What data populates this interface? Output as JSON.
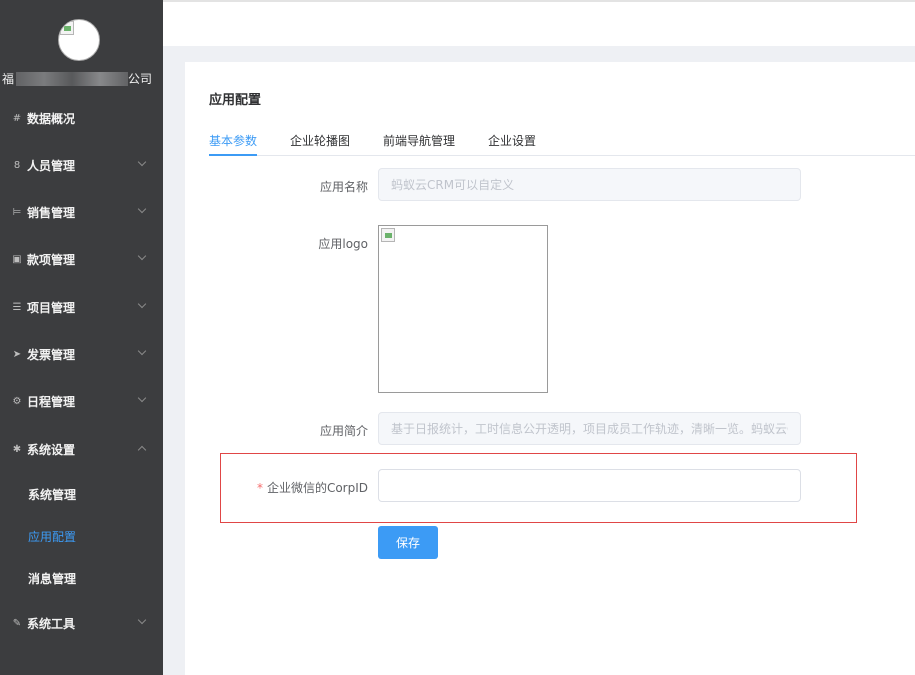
{
  "sidebar": {
    "company": {
      "prefix": "福",
      "suffix": "公司"
    },
    "items": [
      {
        "icon": "#",
        "label": "数据概况"
      },
      {
        "icon": "8",
        "label": "人员管理"
      },
      {
        "icon": "⊨",
        "label": "销售管理"
      },
      {
        "icon": "▣",
        "label": "款项管理"
      },
      {
        "icon": "☰",
        "label": "项目管理"
      },
      {
        "icon": "➤",
        "label": "发票管理"
      },
      {
        "icon": "⚙",
        "label": "日程管理"
      },
      {
        "icon": "✱",
        "label": "系统设置"
      },
      {
        "icon": "✎",
        "label": "系统工具"
      }
    ],
    "subitems": [
      {
        "label": "系统管理"
      },
      {
        "label": "应用配置"
      },
      {
        "label": "消息管理"
      }
    ]
  },
  "page": {
    "title": "应用配置",
    "tabs": [
      "基本参数",
      "企业轮播图",
      "前端导航管理",
      "企业设置"
    ]
  },
  "form": {
    "app_name_label": "应用名称",
    "app_name_placeholder": "蚂蚁云CRM可以自定义",
    "app_logo_label": "应用logo",
    "app_intro_label": "应用简介",
    "app_intro_placeholder": "基于日报统计，工时信息公开透明，项目成员工作轨迹，清晰一览。蚂蚁云CRM",
    "corpid_required": "*",
    "corpid_label": "企业微信的CorpID",
    "corpid_value": "",
    "save_label": "保存"
  },
  "colors": {
    "accent": "#3c9bf5",
    "sidebar": "#3c3d3f",
    "highlight": "#e04646"
  }
}
